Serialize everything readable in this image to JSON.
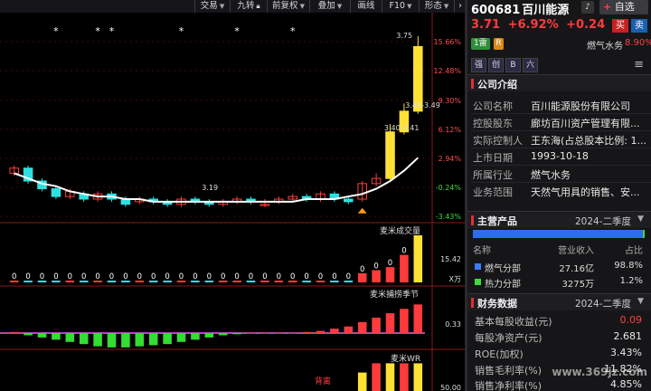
{
  "toolbar": {
    "items": [
      "交易",
      "九转",
      "前复权",
      "叠加",
      "画线",
      "F10",
      "形态"
    ]
  },
  "main_chart": {
    "right_axis_ticks": [
      "15.66%",
      "12.48%",
      "9.30%",
      "6.12%",
      "2.94%",
      "-0.24%",
      "-3.43%"
    ],
    "price_labels": {
      "high": "3.75",
      "mid": "3.48-3.49",
      "low": "3.40-3.41",
      "min": "3.19"
    }
  },
  "chart_data": [
    {
      "type": "candlestick",
      "title": "",
      "x": [
        1,
        2,
        3,
        4,
        5,
        6,
        7,
        8,
        9,
        10,
        11,
        12,
        13,
        14,
        15,
        16,
        17,
        18,
        19,
        20,
        21,
        22,
        23,
        24,
        25,
        26,
        27,
        28,
        29,
        30
      ],
      "open": [
        3.22,
        3.24,
        3.19,
        3.16,
        3.13,
        3.14,
        3.12,
        3.14,
        3.12,
        3.11,
        3.12,
        3.11,
        3.1,
        3.12,
        3.11,
        3.1,
        3.11,
        3.12,
        3.1,
        3.11,
        3.12,
        3.13,
        3.12,
        3.14,
        3.12,
        3.12,
        3.18,
        3.2,
        3.38,
        3.46
      ],
      "close": [
        3.24,
        3.19,
        3.16,
        3.13,
        3.15,
        3.12,
        3.14,
        3.12,
        3.1,
        3.12,
        3.11,
        3.1,
        3.12,
        3.11,
        3.1,
        3.11,
        3.12,
        3.11,
        3.1,
        3.12,
        3.13,
        3.12,
        3.14,
        3.12,
        3.11,
        3.18,
        3.2,
        3.38,
        3.46,
        3.71
      ],
      "high": [
        3.25,
        3.25,
        3.2,
        3.17,
        3.16,
        3.15,
        3.15,
        3.15,
        3.13,
        3.13,
        3.13,
        3.12,
        3.13,
        3.13,
        3.12,
        3.12,
        3.13,
        3.13,
        3.12,
        3.13,
        3.14,
        3.14,
        3.15,
        3.15,
        3.13,
        3.19,
        3.22,
        3.41,
        3.49,
        3.75
      ],
      "low": [
        3.21,
        3.18,
        3.15,
        3.12,
        3.12,
        3.11,
        3.11,
        3.11,
        3.09,
        3.1,
        3.1,
        3.09,
        3.09,
        3.1,
        3.09,
        3.09,
        3.1,
        3.1,
        3.09,
        3.1,
        3.11,
        3.11,
        3.11,
        3.11,
        3.1,
        3.11,
        3.17,
        3.19,
        3.37,
        3.45
      ],
      "ma": [
        3.22,
        3.2,
        3.18,
        3.17,
        3.15,
        3.14,
        3.13,
        3.13,
        3.12,
        3.12,
        3.11,
        3.11,
        3.11,
        3.11,
        3.11,
        3.11,
        3.11,
        3.11,
        3.11,
        3.11,
        3.11,
        3.12,
        3.12,
        3.12,
        3.13,
        3.14,
        3.16,
        3.19,
        3.23,
        3.28
      ],
      "ylim": [
        3.05,
        3.82
      ],
      "star_markers_x": [
        4,
        7,
        8,
        13,
        17,
        21
      ],
      "markers": [
        {
          "x": 15,
          "symbol": "3.19"
        }
      ]
    },
    {
      "type": "bar",
      "title": "麦米成交量",
      "series": [
        {
          "values": [
            0,
            0,
            0,
            0,
            0,
            0,
            0,
            0,
            0,
            0,
            0,
            0,
            0,
            0,
            0,
            0,
            0,
            0,
            0,
            0,
            0,
            0,
            0,
            0,
            0,
            3,
            4,
            5,
            9,
            15.42
          ]
        }
      ],
      "value_labels": [
        "0",
        "0",
        "0",
        "0",
        "0",
        "0",
        "0",
        "0",
        "0",
        "0",
        "0",
        "0",
        "0",
        "0",
        "0",
        "0",
        "0",
        "0",
        "0",
        "0",
        "0",
        "0",
        "0",
        "0",
        "0",
        "0",
        "0",
        "0",
        "0",
        ""
      ],
      "axis_ticks": [
        "15.42",
        "X万"
      ],
      "ylim": [
        0,
        16
      ]
    },
    {
      "type": "bar",
      "title": "麦米捕捞季节",
      "series": [
        {
          "values": [
            0.5,
            -1,
            -2,
            -3,
            -4,
            -5,
            -6,
            -6.5,
            -6.5,
            -6,
            -5.5,
            -5,
            -4,
            -3,
            -2,
            -1,
            -0.5,
            0,
            0,
            0,
            0,
            0.5,
            1,
            2,
            3,
            5,
            7,
            9,
            11,
            13
          ]
        }
      ],
      "axis_ticks": [
        "0.33"
      ],
      "ylim": [
        -8,
        15
      ]
    },
    {
      "type": "bar",
      "title": "麦米WR",
      "series": [
        {
          "values": [
            50,
            50,
            50,
            50,
            50,
            50,
            50,
            50,
            50,
            50,
            50,
            50,
            50,
            50,
            50,
            50,
            50,
            50,
            50,
            50,
            50,
            50,
            50,
            50,
            50,
            80,
            95,
            95,
            95,
            95
          ]
        }
      ],
      "annotations": [
        "背离"
      ],
      "axis_ticks": [
        "50.00"
      ],
      "ylim": [
        0,
        100
      ]
    }
  ],
  "stock": {
    "code": "600681",
    "name": "百川能源",
    "price": "3.71",
    "change_pct": "+6.92%",
    "change": "+0.24",
    "star_button": "自选",
    "buy": "买",
    "sell": "卖",
    "badge_rank": "1",
    "badge_rank_label": "雷",
    "badge_r": "R",
    "industry": "燃气水务",
    "industry_change": "8.90%",
    "tags": [
      "强",
      "创",
      "B",
      "六"
    ],
    "add_icon": "+"
  },
  "company": {
    "title": "公司介绍",
    "rows": [
      {
        "k": "公司名称",
        "v": "百川能源股份有限公司"
      },
      {
        "k": "控股股东",
        "v": "廊坊百川资产管理有限..."
      },
      {
        "k": "实际控制人",
        "v": "王东海(占总股本比例: 1..."
      },
      {
        "k": "上市日期",
        "v": "1993-10-18"
      },
      {
        "k": "所属行业",
        "v": "燃气水务"
      },
      {
        "k": "业务范围",
        "v": "天然气用具的销售、安..."
      }
    ]
  },
  "products": {
    "title": "主营产品",
    "period": "2024-二季度",
    "headers": [
      "名称",
      "营业收入",
      "占比"
    ],
    "rows": [
      {
        "name": "燃气分部",
        "revenue": "27.16亿",
        "ratio": "98.8%",
        "color": "#3c7bff"
      },
      {
        "name": "热力分部",
        "revenue": "3275万",
        "ratio": "1.2%",
        "color": "#3ddc3d"
      }
    ],
    "share": [
      0.988,
      0.012
    ]
  },
  "finance": {
    "title": "财务数据",
    "period": "2024-二季度",
    "rows": [
      {
        "k": "基本每股收益(元)",
        "v": "0.09"
      },
      {
        "k": "每股净资产(元)",
        "v": "2.681"
      },
      {
        "k": "ROE(加权)",
        "v": "3.43%"
      },
      {
        "k": "销售毛利率(%)",
        "v": "11.82%"
      },
      {
        "k": "销售净利率(%)",
        "v": "4.85%"
      }
    ]
  },
  "watermark": "www.369jz.com",
  "colors": {
    "up": "#ff3b3b",
    "down": "#2ee0e0",
    "yellow": "#ffe135",
    "green": "#33dd33",
    "accent": "#e03030",
    "ma": "#ffffff"
  }
}
